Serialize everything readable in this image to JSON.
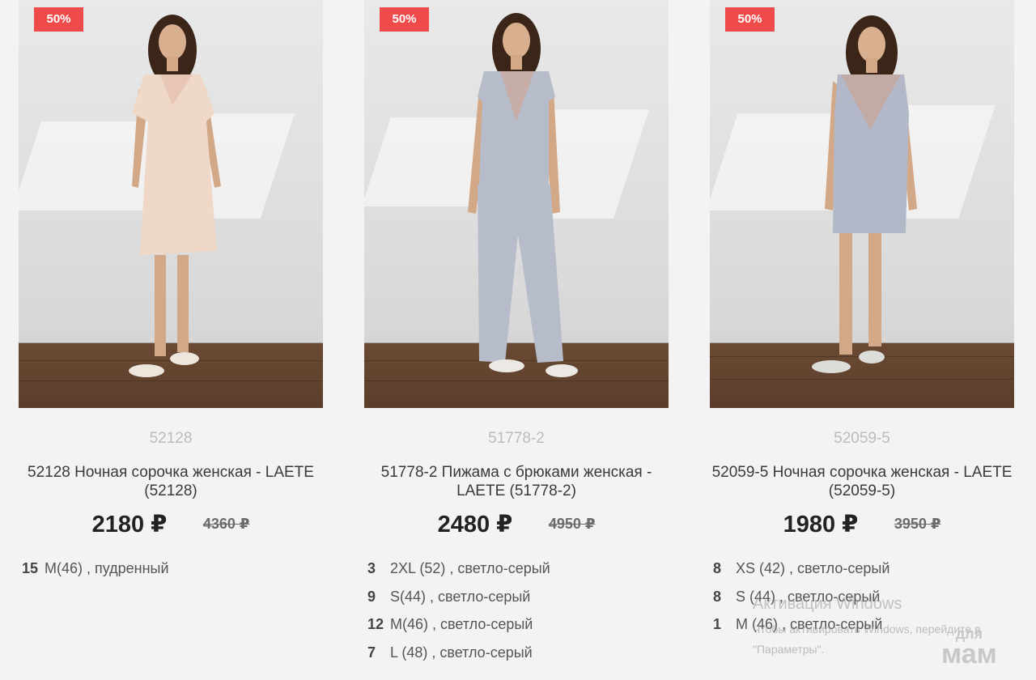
{
  "products": [
    {
      "discount_badge": "50%",
      "sku": "52128",
      "title": "52128 Ночная сорочка женская - LAETE (52128)",
      "price_new": "2180 ₽",
      "price_old": "4360 ₽",
      "image_alt": "Ночная сорочка пудренного цвета",
      "garment_color": "#f0d8c8",
      "stock": [
        {
          "qty": "15",
          "label": "M(46) , пудренный"
        }
      ]
    },
    {
      "discount_badge": "50%",
      "sku": "51778-2",
      "title": "51778-2 Пижама с брюками женская - LAETE (51778-2)",
      "price_new": "2480 ₽",
      "price_old": "4950 ₽",
      "image_alt": "Пижама с брюками светло-серая",
      "garment_color": "#b7bccb",
      "stock": [
        {
          "qty": "3",
          "label": "2XL (52) , светло-серый"
        },
        {
          "qty": "9",
          "label": "S(44) , светло-серый"
        },
        {
          "qty": "12",
          "label": "M(46) , светло-серый"
        },
        {
          "qty": "7",
          "label": "L (48) , светло-серый"
        }
      ]
    },
    {
      "discount_badge": "50%",
      "sku": "52059-5",
      "title": "52059-5 Ночная сорочка женская - LAETE (52059-5)",
      "price_new": "1980 ₽",
      "price_old": "3950 ₽",
      "image_alt": "Ночная сорочка светло-серая",
      "garment_color": "#b3b8c9",
      "stock": [
        {
          "qty": "8",
          "label": "XS (42) , светло-серый"
        },
        {
          "qty": "8",
          "label": "S (44) , светло-серый"
        },
        {
          "qty": "1",
          "label": "M (46) , светло-серый"
        }
      ]
    }
  ],
  "overlay": {
    "activation_title": "Активация Windows",
    "activation_text": "Чтобы активировать Windows, перейдите в\n\"Параметры\".",
    "logo_line1": "для",
    "logo_line2": "мам"
  },
  "colors": {
    "badge": "#ef4b4b",
    "sku_text": "#bcbcbc",
    "background": "#f3f3f3"
  }
}
